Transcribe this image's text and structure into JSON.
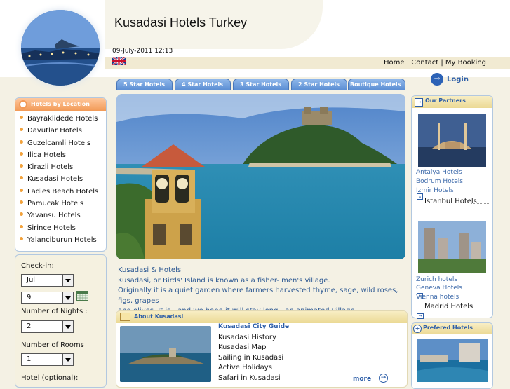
{
  "header": {
    "title": "Kusadasi Hotels Turkey",
    "datetime": "09-July-2011 12:13",
    "flag_icon": "uk-flag-icon",
    "links": [
      "Home",
      "Contact",
      "My Booking"
    ],
    "separator": " | "
  },
  "tabs": [
    "5 Star Hotels",
    "4 Star Hotels",
    "3 Star Hotels",
    "2 Star Hotels",
    "Boutique Hotels"
  ],
  "login": {
    "label": "Login",
    "icon": "key-icon"
  },
  "locations": {
    "title": "Hotels by Location",
    "items": [
      "Bayraklidede Hotels",
      "Davutlar Hotels",
      "Guzelcamli Hotels",
      "Ilica Hotels",
      "Kirazli Hotels",
      "Kusadasi Hotels",
      "Ladies Beach Hotels",
      "Pamucak Hotels",
      "Yavansu Hotels",
      "Sirince Hotels",
      "Yalanciburun Hotels"
    ]
  },
  "booking": {
    "checkin_label": "Check-in:",
    "month": "Jul",
    "day": "9",
    "nights_label": "Number of Nights :",
    "nights": "2",
    "rooms_label": "Number of Rooms",
    "rooms": "1",
    "hotel_label": "Hotel (optional):"
  },
  "intro": {
    "lines": [
      "Kusadasi & Hotels",
      "Kusadasi, or Birds' Island is known as a fisher- men's village.",
      "Originally it is a quiet garden where farmers harvested thyme, sage, wild roses, figs, grapes",
      "and olives. It is - and we hope it will stay long - an animated village."
    ]
  },
  "about": {
    "title": "About Kusadasi",
    "links": [
      "Kusadasi City Guide",
      "Kusadasi History",
      "Kusadasi Map",
      "Sailing in Kusadasi",
      "Active Holidays",
      "Safari in Kusadasi"
    ],
    "more": "more"
  },
  "partners": {
    "title": "Our Partners",
    "group1_links": [
      "Antalya Hotels",
      "Bodrum Hotels",
      "Izmir Hotels"
    ],
    "group1_featured": "Istanbul Hotels",
    "group2_links": [
      "Zurich hotels",
      "Geneva Hotels",
      "Vienna hotels"
    ],
    "group2_featured": "Madrid Hotels"
  },
  "preferred": {
    "title": "Prefered Hotels"
  },
  "colors": {
    "tab": "#5c8fd4",
    "link": "#2d5ea8",
    "accent_orange": "#f29a57",
    "bg": "#f4f1e4"
  }
}
